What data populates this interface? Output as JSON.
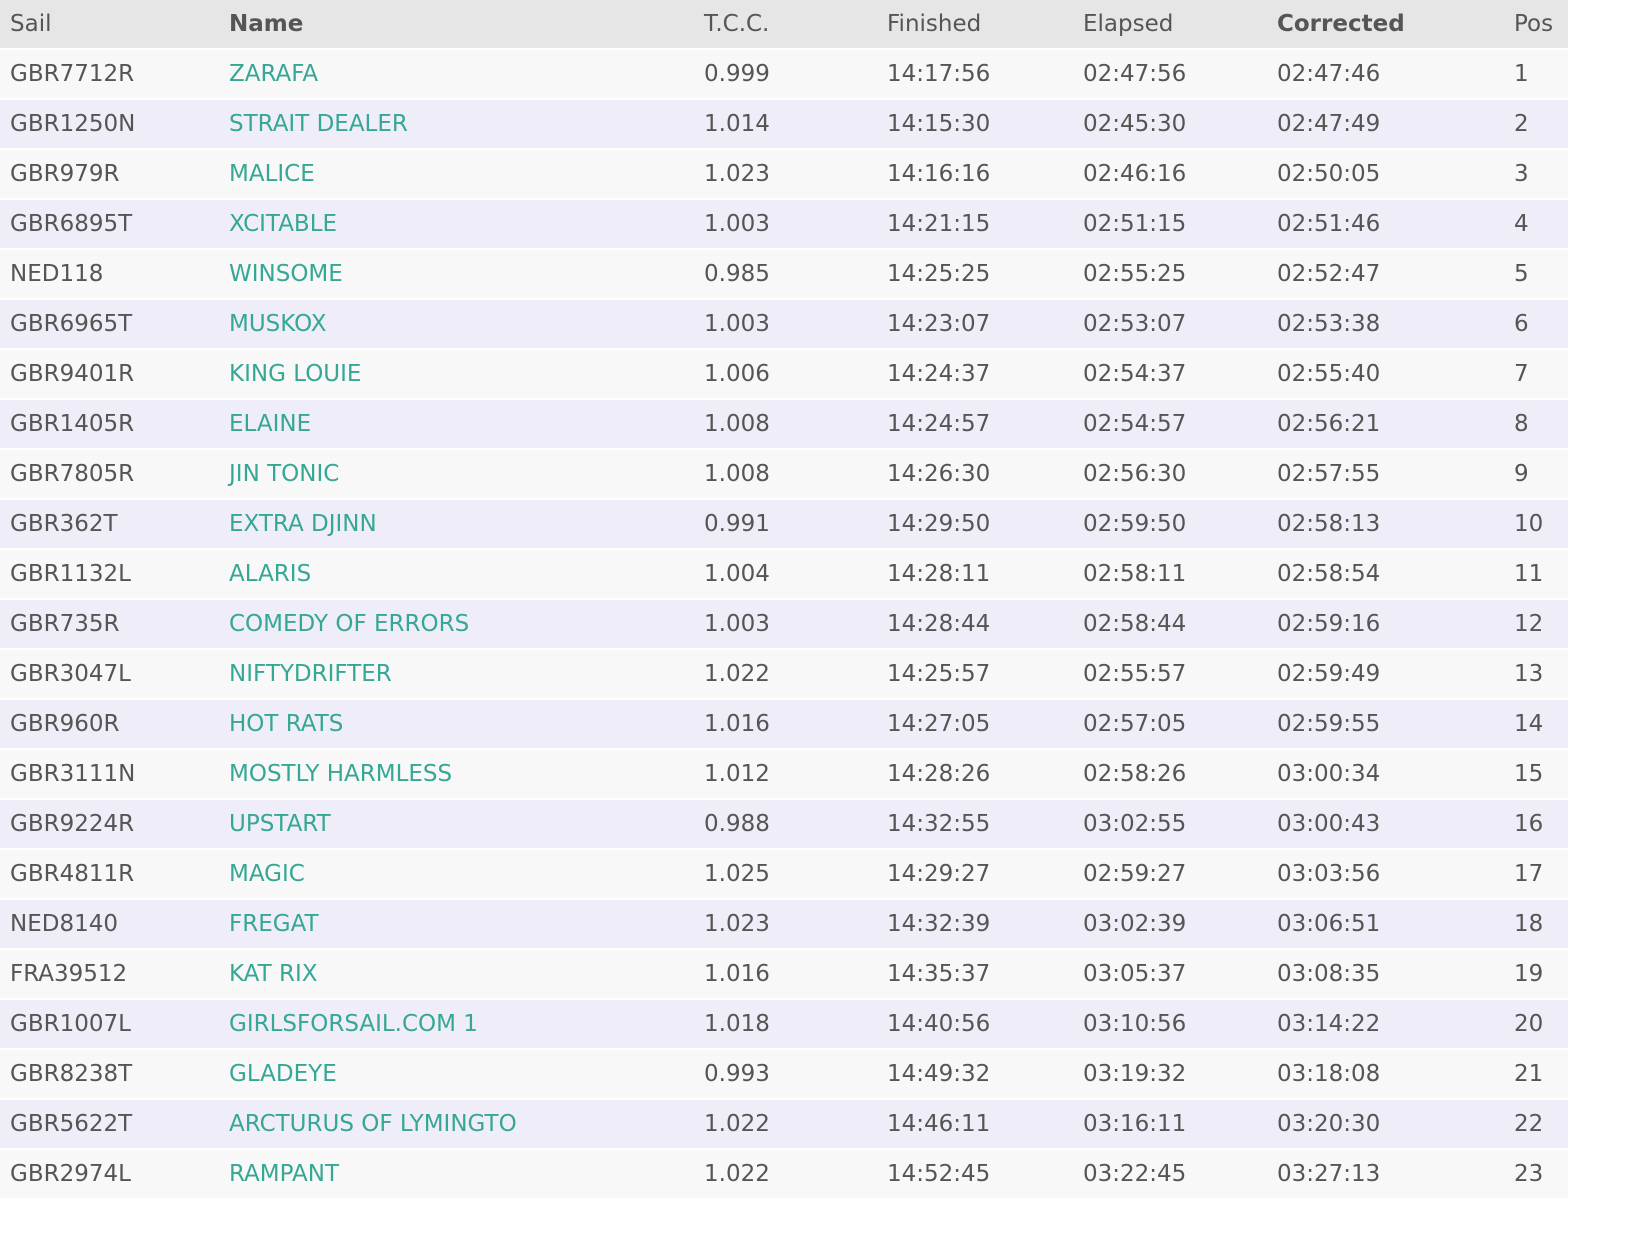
{
  "table": {
    "headers": {
      "sail": "Sail",
      "name": "Name",
      "tcc": "T.C.C.",
      "finished": "Finished",
      "elapsed": "Elapsed",
      "corrected": "Corrected",
      "pos": "Pos"
    },
    "rows": [
      {
        "sail": "GBR7712R",
        "name": "ZARAFA",
        "tcc": "0.999",
        "finished": "14:17:56",
        "elapsed": "02:47:56",
        "corrected": "02:47:46",
        "pos": "1"
      },
      {
        "sail": "GBR1250N",
        "name": "STRAIT DEALER",
        "tcc": "1.014",
        "finished": "14:15:30",
        "elapsed": "02:45:30",
        "corrected": "02:47:49",
        "pos": "2"
      },
      {
        "sail": "GBR979R",
        "name": "MALICE",
        "tcc": "1.023",
        "finished": "14:16:16",
        "elapsed": "02:46:16",
        "corrected": "02:50:05",
        "pos": "3"
      },
      {
        "sail": "GBR6895T",
        "name": "XCITABLE",
        "tcc": "1.003",
        "finished": "14:21:15",
        "elapsed": "02:51:15",
        "corrected": "02:51:46",
        "pos": "4"
      },
      {
        "sail": "NED118",
        "name": "WINSOME",
        "tcc": "0.985",
        "finished": "14:25:25",
        "elapsed": "02:55:25",
        "corrected": "02:52:47",
        "pos": "5"
      },
      {
        "sail": "GBR6965T",
        "name": "MUSKOX",
        "tcc": "1.003",
        "finished": "14:23:07",
        "elapsed": "02:53:07",
        "corrected": "02:53:38",
        "pos": "6"
      },
      {
        "sail": "GBR9401R",
        "name": "KING LOUIE",
        "tcc": "1.006",
        "finished": "14:24:37",
        "elapsed": "02:54:37",
        "corrected": "02:55:40",
        "pos": "7"
      },
      {
        "sail": "GBR1405R",
        "name": "ELAINE",
        "tcc": "1.008",
        "finished": "14:24:57",
        "elapsed": "02:54:57",
        "corrected": "02:56:21",
        "pos": "8"
      },
      {
        "sail": "GBR7805R",
        "name": "JIN TONIC",
        "tcc": "1.008",
        "finished": "14:26:30",
        "elapsed": "02:56:30",
        "corrected": "02:57:55",
        "pos": "9"
      },
      {
        "sail": "GBR362T",
        "name": "EXTRA DJINN",
        "tcc": "0.991",
        "finished": "14:29:50",
        "elapsed": "02:59:50",
        "corrected": "02:58:13",
        "pos": "10"
      },
      {
        "sail": "GBR1132L",
        "name": "ALARIS",
        "tcc": "1.004",
        "finished": "14:28:11",
        "elapsed": "02:58:11",
        "corrected": "02:58:54",
        "pos": "11"
      },
      {
        "sail": "GBR735R",
        "name": "COMEDY OF ERRORS",
        "tcc": "1.003",
        "finished": "14:28:44",
        "elapsed": "02:58:44",
        "corrected": "02:59:16",
        "pos": "12"
      },
      {
        "sail": "GBR3047L",
        "name": "NIFTYDRIFTER",
        "tcc": "1.022",
        "finished": "14:25:57",
        "elapsed": "02:55:57",
        "corrected": "02:59:49",
        "pos": "13"
      },
      {
        "sail": "GBR960R",
        "name": "HOT RATS",
        "tcc": "1.016",
        "finished": "14:27:05",
        "elapsed": "02:57:05",
        "corrected": "02:59:55",
        "pos": "14"
      },
      {
        "sail": "GBR3111N",
        "name": "MOSTLY HARMLESS",
        "tcc": "1.012",
        "finished": "14:28:26",
        "elapsed": "02:58:26",
        "corrected": "03:00:34",
        "pos": "15"
      },
      {
        "sail": "GBR9224R",
        "name": "UPSTART",
        "tcc": "0.988",
        "finished": "14:32:55",
        "elapsed": "03:02:55",
        "corrected": "03:00:43",
        "pos": "16"
      },
      {
        "sail": "GBR4811R",
        "name": "MAGIC",
        "tcc": "1.025",
        "finished": "14:29:27",
        "elapsed": "02:59:27",
        "corrected": "03:03:56",
        "pos": "17"
      },
      {
        "sail": "NED8140",
        "name": "FREGAT",
        "tcc": "1.023",
        "finished": "14:32:39",
        "elapsed": "03:02:39",
        "corrected": "03:06:51",
        "pos": "18"
      },
      {
        "sail": "FRA39512",
        "name": "KAT RIX",
        "tcc": "1.016",
        "finished": "14:35:37",
        "elapsed": "03:05:37",
        "corrected": "03:08:35",
        "pos": "19"
      },
      {
        "sail": "GBR1007L",
        "name": "GIRLSFORSAIL.COM 1",
        "tcc": "1.018",
        "finished": "14:40:56",
        "elapsed": "03:10:56",
        "corrected": "03:14:22",
        "pos": "20"
      },
      {
        "sail": "GBR8238T",
        "name": "GLADEYE",
        "tcc": "0.993",
        "finished": "14:49:32",
        "elapsed": "03:19:32",
        "corrected": "03:18:08",
        "pos": "21"
      },
      {
        "sail": "GBR5622T",
        "name": "ARCTURUS OF LYMINGTO",
        "tcc": "1.022",
        "finished": "14:46:11",
        "elapsed": "03:16:11",
        "corrected": "03:20:30",
        "pos": "22"
      },
      {
        "sail": "GBR2974L",
        "name": "RAMPANT",
        "tcc": "1.022",
        "finished": "14:52:45",
        "elapsed": "03:22:45",
        "corrected": "03:27:13",
        "pos": "23"
      }
    ]
  },
  "colors": {
    "header_bg": "#e6e6e6",
    "row_odd": "#f8f8f8",
    "row_even": "#efeef8",
    "text": "#555555",
    "link": "#36a795"
  }
}
